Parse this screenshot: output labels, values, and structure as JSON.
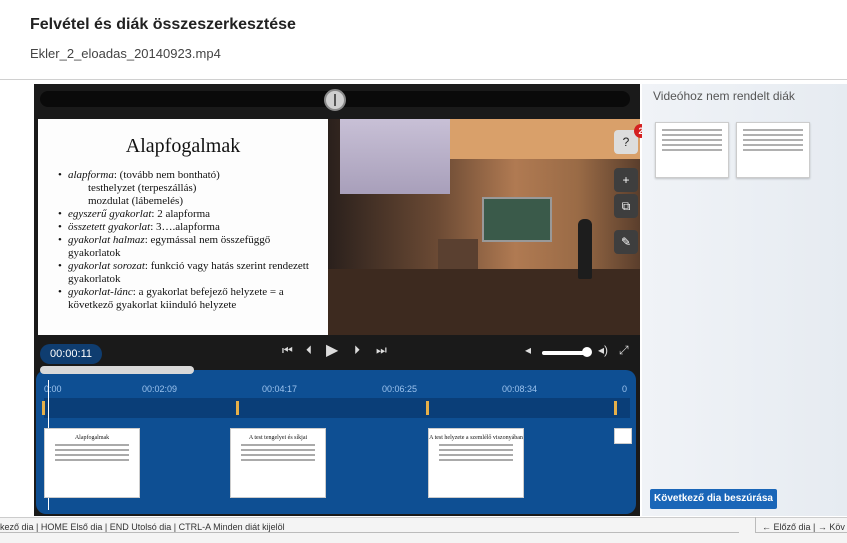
{
  "page": {
    "title": "Felvétel és diák összeszerkesztése",
    "filename": "Ekler_2_eloadas_20140923.mp4"
  },
  "slide": {
    "title": "Alapfogalmak",
    "items": [
      {
        "em": "alapforma",
        "rest": ": (tovább nem bontható)"
      },
      {
        "em": "",
        "rest": "testhelyzet (terpeszállás)",
        "sub": true
      },
      {
        "em": "",
        "rest": "mozdulat (lábemelés)",
        "sub": true
      },
      {
        "em": "egyszerű gyakorlat",
        "rest": ": 2 alapforma"
      },
      {
        "em": "összetett gyakorlat",
        "rest": ": 3….alapforma"
      },
      {
        "em": "gyakorlat halmaz",
        "rest": ": egymással nem összefüggő gyakorlatok"
      },
      {
        "em": "gyakorlat sorozat",
        "rest": ": funkció vagy hatás szerint rendezett gyakorlatok"
      },
      {
        "em": "gyakorlat-lánc",
        "rest": ": a gyakorlat befejező helyzete = a következő gyakorlat kiinduló helyzete"
      }
    ]
  },
  "tools": {
    "badge_count": "2",
    "icons": [
      "help-slide-icon",
      "add-slide-icon",
      "copy-slide-icon",
      "edit-slide-icon"
    ]
  },
  "controls": {
    "time": "00:00:11",
    "icons": [
      "skip-start-icon",
      "prev-icon",
      "play-icon",
      "next-icon",
      "skip-end-icon",
      "volume-low-icon",
      "volume-high-icon",
      "fullscreen-icon"
    ]
  },
  "timeline": {
    "ticks": [
      "0:00",
      "00:02:09",
      "00:04:17",
      "00:06:25",
      "00:08:34",
      "0"
    ],
    "thumbs": [
      {
        "title": "Alapfogalmak"
      },
      {
        "title": "A test tengelyei és síkjai"
      },
      {
        "title": "A test helyzete a szemlélő viszonyában"
      }
    ]
  },
  "right_panel": {
    "heading": "Videóhoz nem rendelt diák",
    "insert_button": "Következő dia beszúrása"
  },
  "footer": {
    "left_hint": "kező dia | HOME Első dia | END Utolsó dia | CTRL-A Minden diát kijelöl",
    "right_hint": "← Előző dia | → Köv"
  },
  "colors": {
    "timeline": "#0e4f93",
    "button": "#1a66b8",
    "badge": "#d42020",
    "marker": "#e6b04a"
  }
}
